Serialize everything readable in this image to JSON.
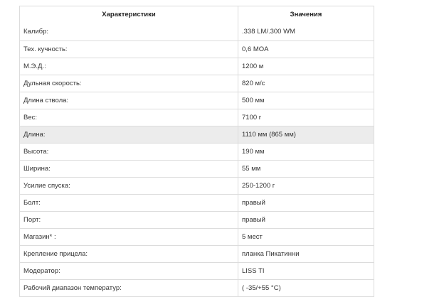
{
  "table": {
    "headers": [
      "Характеристики",
      "Значения"
    ],
    "rows": [
      {
        "label": "Калибр:",
        "value": ".338 LM/.300 WM"
      },
      {
        "label": "Тех. кучность:",
        "value": "0,6 MOA"
      },
      {
        "label": "М.Э.Д.:",
        "value": "1200 м"
      },
      {
        "label": "Дульная скорость:",
        "value": "820 м/с"
      },
      {
        "label": "Длина ствола:",
        "value": "500 мм"
      },
      {
        "label": "Вес:",
        "value": "7100 г"
      },
      {
        "label": "Длина:",
        "value": "1110 мм (865 мм)"
      },
      {
        "label": "Высота:",
        "value": "190 мм"
      },
      {
        "label": "Ширина:",
        "value": "55 мм"
      },
      {
        "label": "Усилие спуска:",
        "value": "250-1200 г"
      },
      {
        "label": "Болт:",
        "value": "правый"
      },
      {
        "label": "Порт:",
        "value": "правый"
      },
      {
        "label": "Магазин* :",
        "value": "5 мест"
      },
      {
        "label": "Крепление прицела:",
        "value": "планка Пикатинни"
      },
      {
        "label": "Модератор:",
        "value": "LISS TI"
      },
      {
        "label": "Рабочий диапазон температур:",
        "value": "( -35/+55 °C)"
      }
    ],
    "highlighted_row": 6
  }
}
